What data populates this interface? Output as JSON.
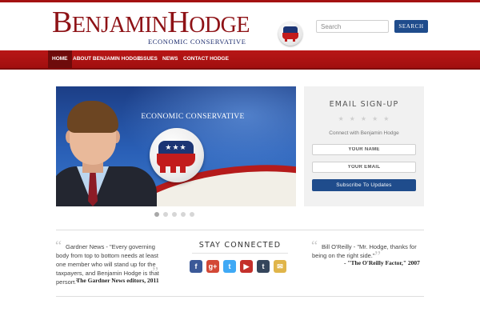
{
  "header": {
    "logo_first": "BENJAMIN",
    "logo_second": "HODGE",
    "logo_tagline": "ECONOMIC CONSERVATIVE",
    "search_placeholder": "Search",
    "search_button": "SEARCH"
  },
  "nav": {
    "items": [
      {
        "label": "HOME",
        "active": true
      },
      {
        "label": "ABOUT BENJAMIN HODGE",
        "active": false
      },
      {
        "label": "ISSUES",
        "active": false
      },
      {
        "label": "NEWS",
        "active": false
      },
      {
        "label": "CONTACT HODGE",
        "active": false
      }
    ]
  },
  "slider": {
    "caption": "ECONOMIC CONSERVATIVE",
    "badge_stars": "★★★",
    "dot_count": 5,
    "active_dot": 1
  },
  "signup": {
    "title": "EMAIL SIGN-UP",
    "stars": "★★★★★",
    "text": "Connect with Benjamin Hodge",
    "name_placeholder": "YOUR NAME",
    "email_placeholder": "YOUR EMAIL",
    "button": "Subscribe To Updates"
  },
  "testimonials": {
    "left": {
      "text": "Gardner News - \"Every governing body from top to bottom needs at least one member who will stand up for the taxpayers, and Benjamin Hodge is that person.\"",
      "author": "- The Gardner News editors, 2011"
    },
    "right": {
      "text": "Bill O'Reilly - \"Mr. Hodge, thanks for being on the right side.\"",
      "author": "- \"The O'Reilly Factor,\" 2007"
    }
  },
  "social": {
    "title": "STAY CONNECTED",
    "icons": [
      {
        "name": "facebook-icon",
        "glyph": "f",
        "color": "#3b5998"
      },
      {
        "name": "google-plus-icon",
        "glyph": "g+",
        "color": "#d34836"
      },
      {
        "name": "twitter-icon",
        "glyph": "t",
        "color": "#3fa9f5"
      },
      {
        "name": "youtube-icon",
        "glyph": "▶",
        "color": "#c4302b"
      },
      {
        "name": "tumblr-icon",
        "glyph": "t",
        "color": "#35465c"
      },
      {
        "name": "rss-icon",
        "glyph": "✉",
        "color": "#e0b54a"
      }
    ]
  },
  "colors": {
    "brand_red": "#a41212",
    "brand_blue": "#1f4c8c"
  }
}
